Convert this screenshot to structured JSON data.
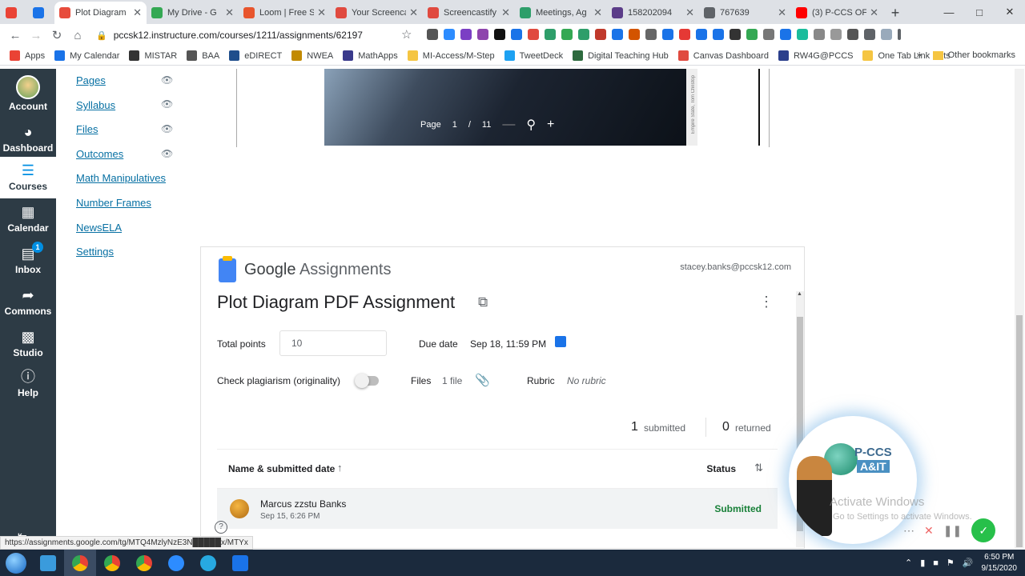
{
  "browser": {
    "tabs": [
      {
        "title": "",
        "color": "#ea4335",
        "active": false,
        "small": true
      },
      {
        "title": "",
        "color": "#1a73e8",
        "active": false,
        "small": true
      },
      {
        "title": "Plot Diagram",
        "color": "#e74c3c",
        "active": true,
        "small": false
      },
      {
        "title": "My Drive - G",
        "color": "#34a853",
        "active": false,
        "small": false
      },
      {
        "title": "Loom | Free S",
        "color": "#e8552d",
        "active": false,
        "small": false
      },
      {
        "title": "Your Screenca",
        "color": "#e04a3f",
        "active": false,
        "small": false
      },
      {
        "title": "Screencastify",
        "color": "#e04a3f",
        "active": false,
        "small": false
      },
      {
        "title": "Meetings, Ag",
        "color": "#2e9e6a",
        "active": false,
        "small": false
      },
      {
        "title": "158202094",
        "color": "#5b3c88",
        "active": false,
        "small": false
      },
      {
        "title": "767639",
        "color": "#5f6368",
        "active": false,
        "small": false
      },
      {
        "title": "(3) P-CCS OF",
        "color": "#ff0000",
        "active": false,
        "small": false
      }
    ],
    "url": "pccsk12.instructure.com/courses/1211/assignments/62197",
    "bookmarks": [
      {
        "label": "Apps",
        "color": "#ea4335"
      },
      {
        "label": "My Calendar",
        "color": "#1a73e8"
      },
      {
        "label": "MISTAR",
        "color": "#333333"
      },
      {
        "label": "BAA",
        "color": "#555555"
      },
      {
        "label": "eDIRECT",
        "color": "#1f4e8c"
      },
      {
        "label": "NWEA",
        "color": "#c28a00"
      },
      {
        "label": "MathApps",
        "color": "#3a3a8c"
      },
      {
        "label": "MI-Access/M-Step",
        "color": "#f5c542"
      },
      {
        "label": "TweetDeck",
        "color": "#1da1f2"
      },
      {
        "label": "Digital Teaching Hub",
        "color": "#2d6a3e"
      },
      {
        "label": "Canvas Dashboard",
        "color": "#e04a3f"
      },
      {
        "label": "RW4G@PCCS",
        "color": "#2b3f8c"
      },
      {
        "label": "One Tab Link Lists",
        "color": "#f5c542"
      }
    ],
    "other_bookmarks": "Other bookmarks",
    "status_url": "https://assignments.google.com/tg/MTQ4MzlyNzE3N█████x/MTYx"
  },
  "global_nav": {
    "account": "Account",
    "dashboard": "Dashboard",
    "courses": "Courses",
    "calendar": "Calendar",
    "inbox": "Inbox",
    "inbox_badge": "1",
    "commons": "Commons",
    "studio": "Studio",
    "help": "Help"
  },
  "course_nav": {
    "pages": "Pages",
    "syllabus": "Syllabus",
    "files": "Files",
    "outcomes": "Outcomes",
    "math_manipulatives": "Math Manipulatives",
    "number_frames": "Number Frames",
    "newsela": "NewsELA",
    "settings": "Settings"
  },
  "pdf_viewer": {
    "page_label": "Page",
    "current_page": "1",
    "separator": "/",
    "total_pages": "11",
    "side_text": "Empire State, Tom Christop"
  },
  "google_assignments": {
    "brand_google": "Google",
    "brand_assignments": "Assignments",
    "email": "stacey.banks@pccsk12.com",
    "title": "Plot Diagram PDF Assignment",
    "total_points_label": "Total points",
    "total_points_value": "10",
    "due_date_label": "Due date",
    "due_date_value": "Sep 18, 11:59 PM",
    "plagiarism_label": "Check plagiarism (originality)",
    "files_label": "Files",
    "files_value": "1 file",
    "rubric_label": "Rubric",
    "rubric_value": "No rubric",
    "submitted_count": "1",
    "submitted_label": "submitted",
    "returned_count": "0",
    "returned_label": "returned",
    "col_name": "Name & submitted date",
    "col_status": "Status",
    "rows": [
      {
        "name": "Marcus zzstu Banks",
        "date": "Sep 15, 6:26 PM",
        "status": "Submitted"
      }
    ]
  },
  "overlay": {
    "brand_line1": "P-CCS",
    "brand_line2": "A&IT",
    "activate_title": "Activate Windows",
    "activate_sub": "Go to Settings to activate Windows."
  },
  "taskbar": {
    "time": "6:50 PM",
    "date": "9/15/2020"
  }
}
